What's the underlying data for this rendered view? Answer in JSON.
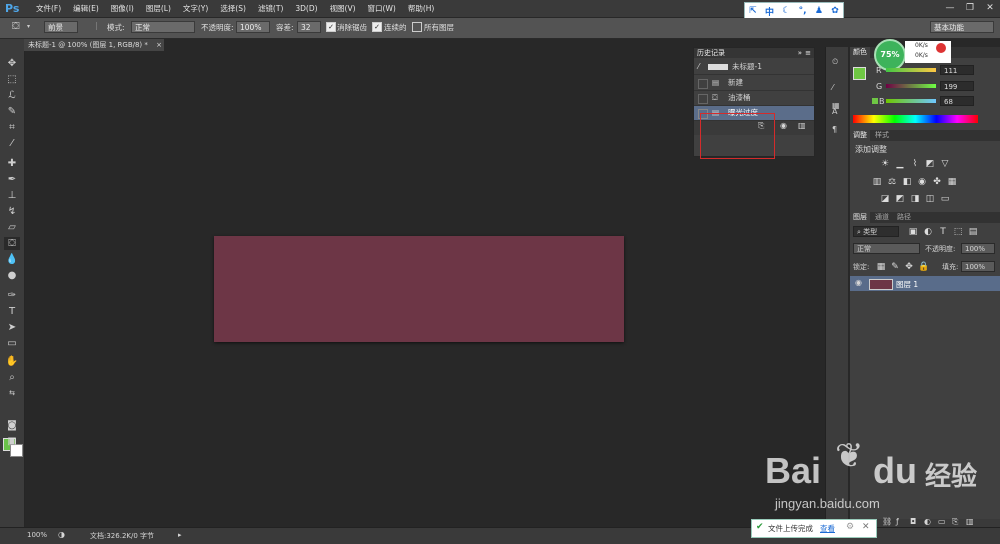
{
  "menu": {
    "logo": "Ps",
    "items": [
      "文件(F)",
      "编辑(E)",
      "图像(I)",
      "图层(L)",
      "文字(Y)",
      "选择(S)",
      "滤镜(T)",
      "3D(D)",
      "视图(V)",
      "窗口(W)",
      "帮助(H)"
    ],
    "ime": [
      "中",
      "☾",
      "°,",
      "♟",
      "✿"
    ]
  },
  "options": {
    "tool_icon": "paint-bucket-icon",
    "fill_source": "前景",
    "mode_label": "模式:",
    "mode_value": "正常",
    "opacity_label": "不透明度:",
    "opacity_value": "100%",
    "tolerance_label": "容差:",
    "tolerance_value": "32",
    "antialias_label": "消除锯齿",
    "contiguous_label": "连续的",
    "all_layers_label": "所有图层",
    "workspace": "基本功能"
  },
  "document": {
    "tab_title": "未标题-1 @ 100% (图层 1, RGB/8) *",
    "zoom": "100%",
    "doc_info": "文档:326.2K/0 字节"
  },
  "history": {
    "title": "历史记录",
    "snapshot": "未标题-1",
    "items": [
      "新建",
      "油漆桶",
      "曝光过度"
    ]
  },
  "color_panel": {
    "tab": "颜色",
    "r": "111",
    "g": "199",
    "b": "68",
    "badge_percent": "75%",
    "net_up": "0K/s",
    "net_down": "0K/s",
    "fg_color": "#6fc744",
    "bg_color": "#ffffff"
  },
  "adjust_panel": {
    "tabs": [
      "调整",
      "样式"
    ],
    "title": "添加调整"
  },
  "layers_panel": {
    "tabs": [
      "图层",
      "通道",
      "路径"
    ],
    "filter_kind": "类型",
    "blend_mode": "正常",
    "opacity_label": "不透明度:",
    "opacity_value": "100%",
    "lock_label": "锁定:",
    "fill_label": "填充:",
    "fill_value": "100%",
    "layer_name": "图层 1"
  },
  "canvas": {
    "fill_color": "#6d3646"
  },
  "notification": {
    "message": "文件上传完成",
    "action": "查看"
  },
  "watermark": {
    "brand": "Bai",
    "paw": "du",
    "cn": "经验",
    "url": "jingyan.baidu.com"
  }
}
